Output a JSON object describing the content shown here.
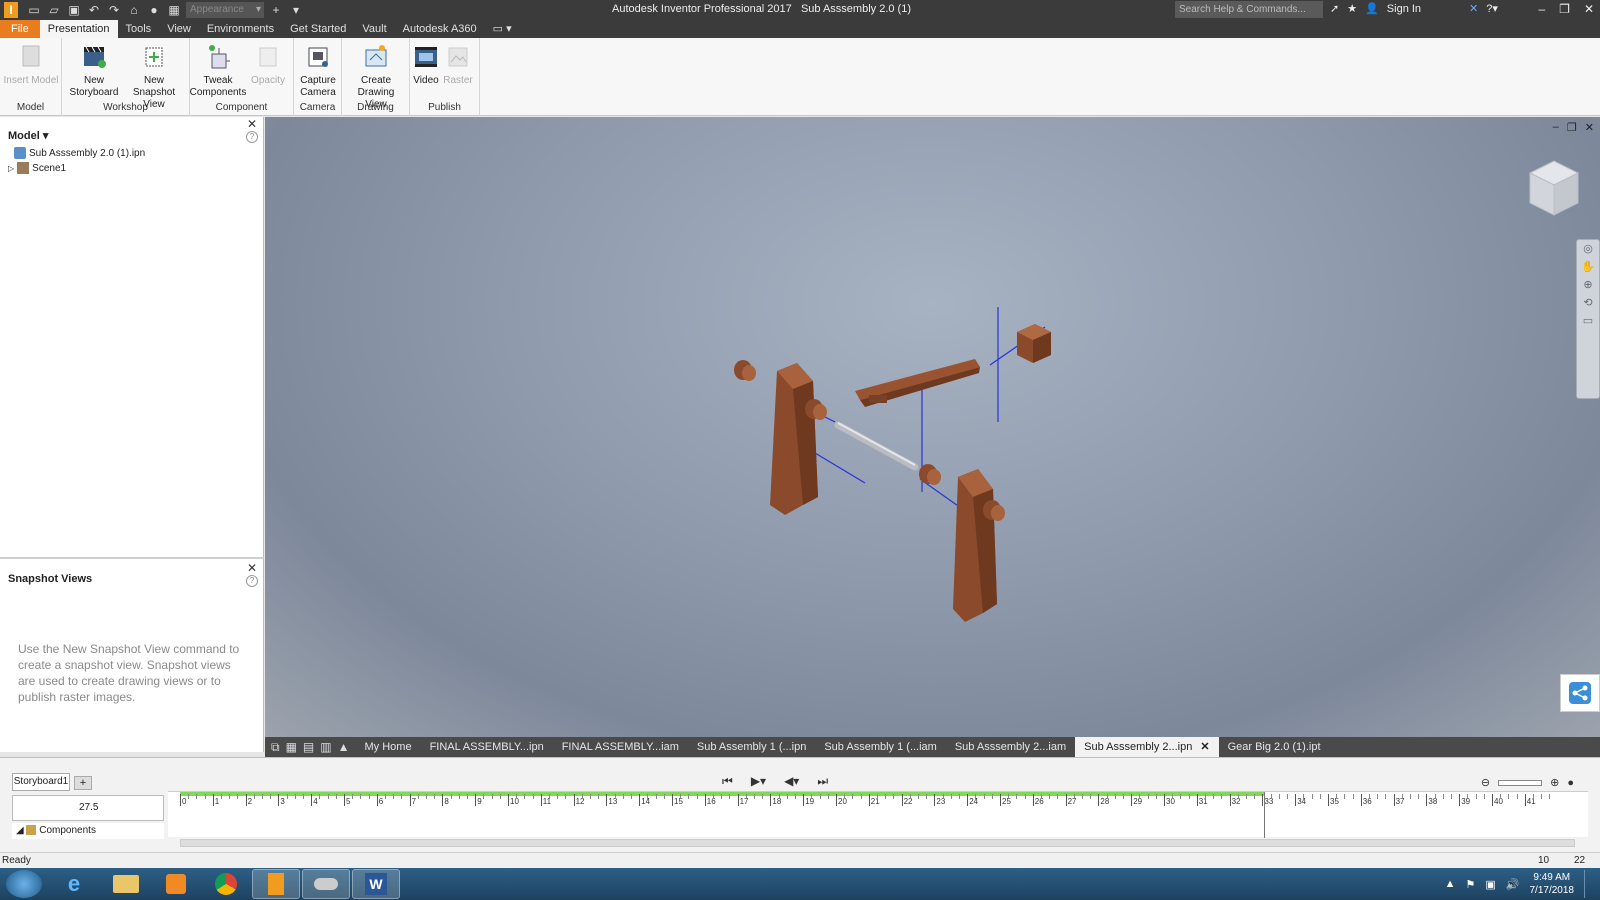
{
  "titlebar": {
    "app_title": "Autodesk Inventor Professional 2017",
    "doc_title": "Sub Asssembly 2.0 (1)",
    "appearance_placeholder": "Appearance",
    "search_placeholder": "Search Help & Commands...",
    "sign_in": "Sign In",
    "logo_letter": "I"
  },
  "menu": {
    "tabs": [
      "File",
      "Presentation",
      "Tools",
      "View",
      "Environments",
      "Get Started",
      "Vault",
      "Autodesk A360"
    ],
    "active": "Presentation"
  },
  "ribbon": {
    "groups": [
      {
        "label": "Model",
        "buttons": [
          {
            "label": "Insert Model",
            "enabled": false
          }
        ]
      },
      {
        "label": "Workshop",
        "buttons": [
          {
            "label": "New Storyboard",
            "enabled": true
          },
          {
            "label": "New Snapshot View",
            "enabled": true
          }
        ]
      },
      {
        "label": "Component",
        "buttons": [
          {
            "label": "Tweak Components",
            "enabled": true
          },
          {
            "label": "Opacity",
            "enabled": false
          }
        ]
      },
      {
        "label": "Camera",
        "buttons": [
          {
            "label": "Capture Camera",
            "enabled": true
          }
        ]
      },
      {
        "label": "Drawing",
        "buttons": [
          {
            "label": "Create Drawing View",
            "enabled": true
          }
        ]
      },
      {
        "label": "Publish",
        "buttons": [
          {
            "label": "Video",
            "enabled": true
          },
          {
            "label": "Raster",
            "enabled": false
          }
        ]
      }
    ]
  },
  "model_panel": {
    "header": "Model",
    "tree": [
      {
        "label": "Sub Asssembly 2.0 (1).ipn",
        "icon": "presentation-icon"
      },
      {
        "label": "Scene1",
        "icon": "scene-icon"
      }
    ]
  },
  "snapshot_panel": {
    "header": "Snapshot Views",
    "hint": "Use the New Snapshot View command to create a snapshot view. Snapshot views are used to create drawing views or to publish raster images."
  },
  "doc_tabs": {
    "tabs": [
      "My Home",
      "FINAL ASSEMBLY...ipn",
      "FINAL ASSEMBLY...iam",
      "Sub Assembly 1 (...ipn",
      "Sub Assembly 1 (...iam",
      "Sub Asssembly 2...iam",
      "Sub Asssembly 2...ipn",
      "Gear Big 2.0 (1).ipt"
    ],
    "active": "Sub Asssembly 2...ipn"
  },
  "storyboard": {
    "tab_label": "Storyboard1",
    "current_time": "27.5",
    "components_label": "Components",
    "tick_labels": [
      "0",
      "1",
      "2",
      "3",
      "4",
      "5",
      "6",
      "7",
      "8",
      "9",
      "10",
      "11",
      "12",
      "13",
      "14",
      "15",
      "16",
      "17",
      "18",
      "19",
      "20",
      "21",
      "22",
      "23",
      "24",
      "25",
      "26",
      "27",
      "28",
      "29",
      "30",
      "31",
      "32",
      "33",
      "34",
      "35",
      "36",
      "37",
      "38",
      "39",
      "40",
      "41"
    ]
  },
  "status": {
    "text": "Ready",
    "num1": "10",
    "num2": "22"
  },
  "taskbar": {
    "time": "9:49 AM",
    "date": "7/17/2018"
  },
  "colors": {
    "file_tab": "#e87c1e",
    "wood": "#8b4a2b",
    "viewport_bg": "#8f9aad",
    "timeline_green": "#7ed957"
  }
}
